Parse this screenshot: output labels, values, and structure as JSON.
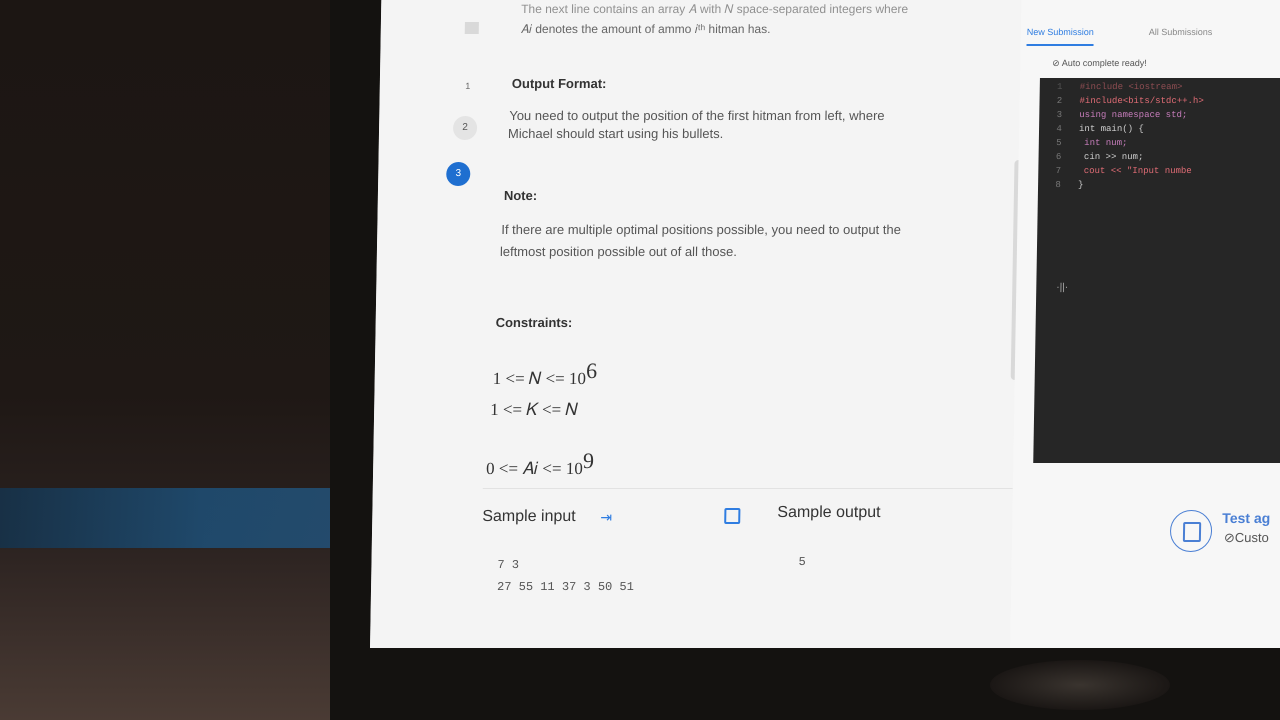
{
  "problem": {
    "intro_line1": "The next line contains an array 𝐴 with 𝑁 space-separated integers where",
    "intro_line2": "𝐴𝑖 denotes the amount of ammo 𝑖ᵗʰ hitman has.",
    "steps": [
      "1",
      "2",
      "3"
    ],
    "output_format": {
      "heading": "Output Format:",
      "line1": "You need to output the position of the first hitman from left, where",
      "line2": "Michael should start using his bullets."
    },
    "note": {
      "heading": "Note:",
      "line1": "If there are multiple optimal positions possible, you need to output the",
      "line2": "leftmost position possible out of all those."
    },
    "constraints": {
      "heading": "Constraints:",
      "c1_base": "1 <= 𝑁 <= 10",
      "c1_exp": "6",
      "c2": "1 <= 𝐾 <= 𝑁",
      "c3_base": "0 <= 𝐴𝑖 <= 10",
      "c3_exp": "9"
    },
    "sample": {
      "input_label": "Sample input",
      "output_label": "Sample output",
      "input_line1": "7 3",
      "input_line2": "27 55 11 37 3 50 51",
      "output_value": "5"
    }
  },
  "right_panel": {
    "tab_new": "New Submission",
    "tab_all": "All Submissions",
    "autocomplete": "Auto complete ready!",
    "test_label": "Test ag",
    "custom_label": "Custo",
    "code_lines": [
      {
        "n": "1",
        "text": "#include <iostream>"
      },
      {
        "n": "2",
        "text": "#include<bits/stdc++.h>"
      },
      {
        "n": "3",
        "text": "using namespace std;"
      },
      {
        "n": "4",
        "text": "int main() {"
      },
      {
        "n": "5",
        "text": "    int num;"
      },
      {
        "n": "6",
        "text": "    cin >> num;"
      },
      {
        "n": "7",
        "text": "    cout << \"Input numbe"
      },
      {
        "n": "8",
        "text": "}"
      }
    ]
  },
  "colors": {
    "accent_blue": "#2f7de1",
    "step_badge_active": "#1f6fd0",
    "editor_bg": "#262626"
  }
}
